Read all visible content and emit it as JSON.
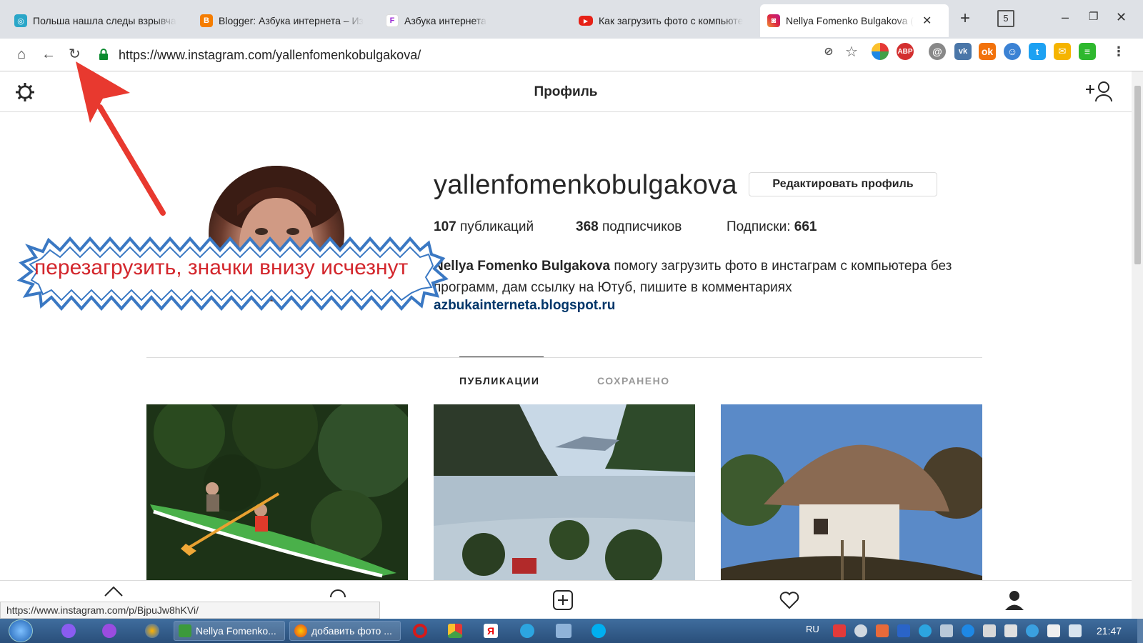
{
  "browser": {
    "tabs": [
      {
        "label": "Польша нашла следы взрывча",
        "favicon": "tab-icon"
      },
      {
        "label": "Blogger: Азбука интернета – Из",
        "favicon": "blogger-icon"
      },
      {
        "label": "Азбука интернета",
        "favicon": "fn-icon"
      },
      {
        "label": "Как загрузить фото с компьюте",
        "favicon": "youtube-icon"
      },
      {
        "label": "Nellya Fomenko Bulgakova (",
        "favicon": "instagram-icon"
      }
    ],
    "tab_count_badge": "5",
    "url": "https://www.instagram.com/yallenfomenkobulgakova/",
    "abp_label": "ABP",
    "status_url": "https://www.instagram.com/p/BjpuJw8hKVi/"
  },
  "page": {
    "header_title": "Профиль",
    "username": "yallenfomenkobulgakova",
    "edit_profile_label": "Редактировать профиль",
    "stats": {
      "posts_count": "107",
      "posts_label": "публикаций",
      "followers_count": "368",
      "followers_label": "подписчиков",
      "following_label": "Подписки:",
      "following_count": "661"
    },
    "bio_name": "Nellya Fomenko Bulgakova",
    "bio_text": " помогу загрузить фото в инстаграм с компьютера без программ, дам ссылку на Ютуб, пишите в комментариях",
    "bio_link": "azbukainterneta.blogspot.ru",
    "tabs": [
      "ПУБЛИКАЦИИ",
      "СОХРАНЕНО"
    ]
  },
  "annotation": {
    "callout_text": "перезагрузить, значки внизу исчезнут"
  },
  "taskbar": {
    "tasks": [
      "Nellya Fomenko...",
      "добавить фото ..."
    ],
    "lang": "RU",
    "clock": "21:47"
  },
  "colors": {
    "callout_text": "#d3262c",
    "callout_border": "#3a78c3",
    "arrow": "#e8392f",
    "link": "#003569"
  }
}
